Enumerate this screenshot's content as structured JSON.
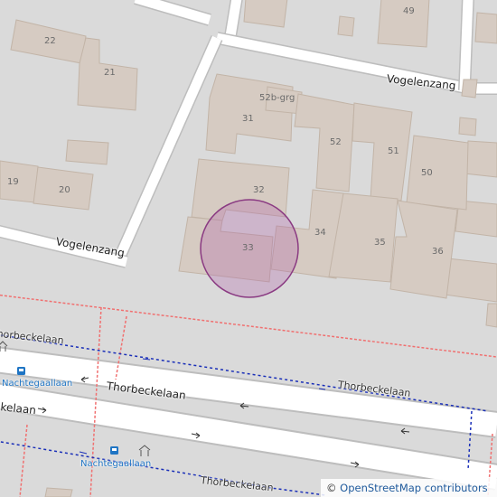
{
  "map": {
    "colors": {
      "background": "#dadada",
      "building": "#d6cbc2",
      "building_stroke": "#c2b4a7",
      "road": "#ffffff",
      "road_casing": "#bdbdbd",
      "footway": "#f07070",
      "bus_route": "#1a2fb8",
      "highlight_fill": "#b05fa8",
      "highlight_stroke": "#8a3a82"
    },
    "house_numbers": [
      "22",
      "21",
      "49",
      "52b-grg",
      "31",
      "52",
      "51",
      "50",
      "19",
      "20",
      "32",
      "34",
      "35",
      "36",
      "33"
    ],
    "streets": {
      "vogelenzang_upper": "Vogelenzang",
      "vogelenzang_lower": "Vogelenzang",
      "thorbeckelaan_top_left": "Thorbeckelaan",
      "thorbeckelaan_main": "Thorbeckelaan",
      "thorbeckelaan_right": "Thorbeckelaan",
      "thorbeckelaan_left": "Thorbeckelaan",
      "thorbeckelaan_bottom": "Thorbeckelaan"
    },
    "bus_stops": {
      "stop_1": "Nachtegaallaan",
      "stop_2": "Nachtegaallaan"
    },
    "icons": [
      "bus-stop-icon",
      "bus-stop-icon",
      "shelter-icon",
      "copyright-icon"
    ],
    "attribution": {
      "prefix": "©",
      "text": "OpenStreetMap contributors"
    }
  }
}
